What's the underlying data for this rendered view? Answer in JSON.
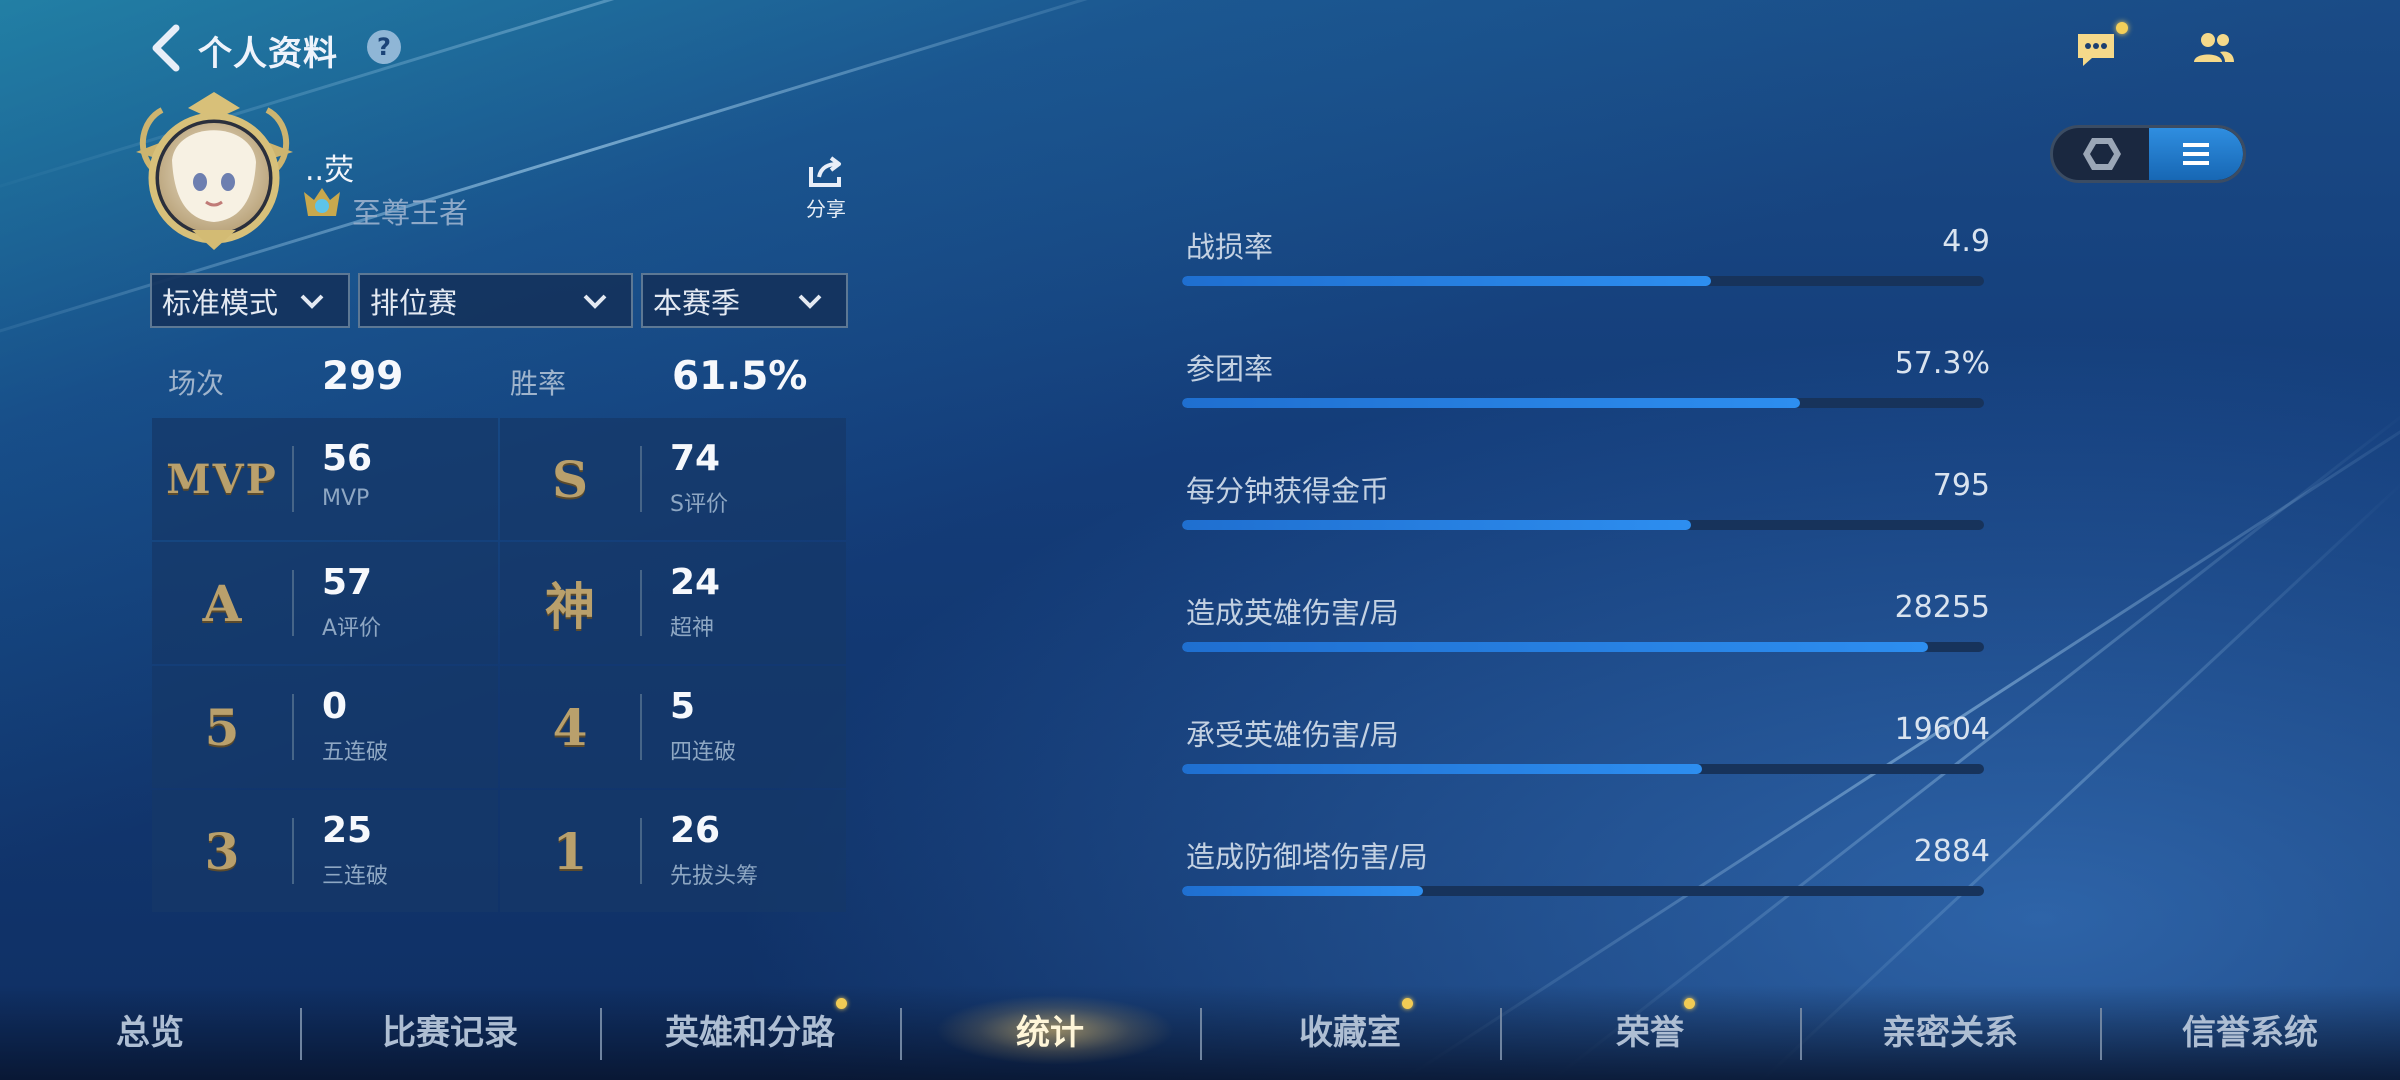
{
  "header": {
    "title": "个人资料",
    "help_label": "?"
  },
  "profile": {
    "nickname": "..荧",
    "rank": "至尊王者",
    "share_label": "分享"
  },
  "filters": {
    "mode": "标准模式",
    "match_type": "排位赛",
    "season": "本赛季"
  },
  "summary": {
    "matches_label": "场次",
    "matches_value": "299",
    "winrate_label": "胜率",
    "winrate_value": "61.5%"
  },
  "stats": [
    {
      "badge": "MVP",
      "value": "56",
      "label": "MVP"
    },
    {
      "badge": "S",
      "value": "74",
      "label": "S评价"
    },
    {
      "badge": "A",
      "value": "57",
      "label": "A评价"
    },
    {
      "badge": "神",
      "value": "24",
      "label": "超神"
    },
    {
      "badge": "5",
      "value": "0",
      "label": "五连破"
    },
    {
      "badge": "4",
      "value": "5",
      "label": "四连破"
    },
    {
      "badge": "3",
      "value": "25",
      "label": "三连破"
    },
    {
      "badge": "1",
      "value": "26",
      "label": "先拔头筹"
    }
  ],
  "metrics": [
    {
      "label": "战损率",
      "value": "4.9",
      "fill": 0.66
    },
    {
      "label": "参团率",
      "value": "57.3%",
      "fill": 0.77
    },
    {
      "label": "每分钟获得金币",
      "value": "795",
      "fill": 0.635
    },
    {
      "label": "造成英雄伤害/局",
      "value": "28255",
      "fill": 0.93
    },
    {
      "label": "承受英雄伤害/局",
      "value": "19604",
      "fill": 0.648
    },
    {
      "label": "造成防御塔伤害/局",
      "value": "2884",
      "fill": 0.3
    }
  ],
  "tabs": [
    {
      "label": "总览",
      "dot": false,
      "active": false
    },
    {
      "label": "比赛记录",
      "dot": false,
      "active": false
    },
    {
      "label": "英雄和分路",
      "dot": true,
      "active": false
    },
    {
      "label": "统计",
      "dot": false,
      "active": true
    },
    {
      "label": "收藏室",
      "dot": true,
      "active": false
    },
    {
      "label": "荣誉",
      "dot": true,
      "active": false
    },
    {
      "label": "亲密关系",
      "dot": false,
      "active": false
    },
    {
      "label": "信誉系统",
      "dot": false,
      "active": false
    }
  ],
  "icons": {
    "back": "chevron-left-icon",
    "help": "question-icon",
    "chat": "chat-icon",
    "friends": "friends-icon",
    "share": "share-icon",
    "view_hex": "hexagon-icon",
    "view_list": "list-icon"
  },
  "colors": {
    "accent": "#2d8ef0",
    "gold": "#b9a06c",
    "notification": "#f3cf5a"
  }
}
